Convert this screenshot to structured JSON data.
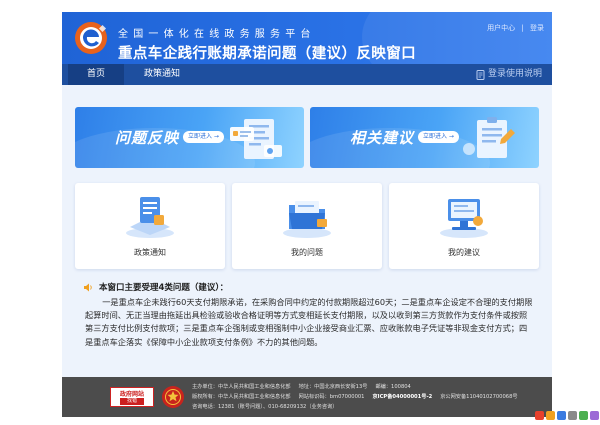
{
  "header": {
    "subtitle": "全国一体化在线政务服务平台",
    "title": "重点车企践行账期承诺问题（建议）反映窗口",
    "links": [
      "用户中心",
      "登录"
    ],
    "link_separator": "|",
    "logo_letter": "e"
  },
  "nav": {
    "items": [
      {
        "label": "首页",
        "active": true
      },
      {
        "label": "政策通知",
        "active": false
      }
    ],
    "guide_label": "登录使用说明",
    "guide_icon": "document-icon"
  },
  "banners": [
    {
      "title": "问题反映",
      "button": "立即进入 →"
    },
    {
      "title": "相关建议",
      "button": "立即进入 →"
    }
  ],
  "cards": [
    {
      "label": "政策通知"
    },
    {
      "label": "我的问题"
    },
    {
      "label": "我的建议"
    }
  ],
  "notice": {
    "icon": "speaker-icon",
    "title": "本窗口主要受理4类问题（建议）：",
    "body": "一是重点车企未践行60天支付期限承诺，在采购合同中约定的付款期限超过60天；二是重点车企设定不合理的支付期限起算时间、无正当理由拖延出具检验或验收合格证明等方式变相延长支付期限，以及以收到第三方货款作为支付条件或按照第三方支付比例支付款项；三是重点车企强制或变相强制中小企业接受商业汇票、应收账款电子凭证等非现金支付方式；四是重点车企落实《保障中小企业款项支付条例》不力的其他问题。"
  },
  "footer": {
    "badge_top": "政府网站",
    "badge_bottom": "找错",
    "lines": [
      [
        "主办单位：",
        "中华人民共和国工业和信息化部",
        "地址：",
        "中国北京西长安街13号",
        "邮编：",
        "100804"
      ],
      [
        "版权所有：",
        "中华人民共和国工业和信息化部",
        "网站标识码：",
        "bm07000001",
        "京ICP备04000001号-2",
        "京公网安备11040102700068号"
      ],
      [
        "咨询电话：",
        "12381（账号问题）、010-68209132（业务咨询）"
      ]
    ]
  },
  "colors": {
    "header_blue": "#1f63d6",
    "nav_blue": "#1e4f9f",
    "main_bg": "#edf3fc",
    "footer_bg": "#4c4c4c",
    "notice_icon": "#f0a020"
  }
}
